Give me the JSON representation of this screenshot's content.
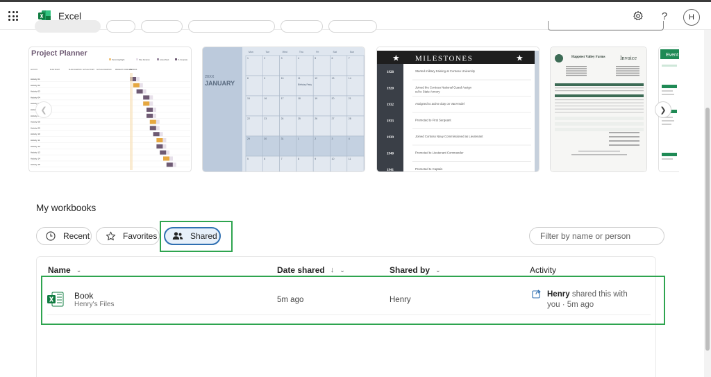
{
  "header": {
    "app_name": "Excel",
    "avatar_initial": "H"
  },
  "templates": {
    "project_planner": {
      "title": "Project Planner",
      "cols": [
        "ACTIVITY",
        "PLAN START",
        "PLAN DURATION",
        "ACTUAL START",
        "ACTUAL DURATION",
        "PERCENT COMPLETE",
        "PERIODS"
      ],
      "rows": [
        "Activity 01",
        "Activity 02",
        "Activity 03",
        "Activity 04",
        "Activity 05",
        "Activity 06",
        "Activity 07",
        "Activity 08",
        "Activity 09",
        "Activity 10",
        "Activity 11",
        "Activity 12",
        "Activity 13",
        "Activity 14",
        "Activity 15"
      ],
      "legend": [
        "Period Highlight",
        "Plan Duration",
        "Actual Start",
        "% Complete"
      ]
    },
    "calendar": {
      "year": "20XX",
      "month": "JANUARY",
      "days": [
        "Mon",
        "Tue",
        "Wed",
        "Thu",
        "Fri",
        "Sat",
        "Sun"
      ],
      "dates": [
        "1",
        "2",
        "3",
        "4",
        "5",
        "6",
        "7",
        "8",
        "9",
        "10",
        "11",
        "12",
        "13",
        "14",
        "15",
        "16",
        "17",
        "18",
        "19",
        "20",
        "21",
        "22",
        "23",
        "24",
        "25",
        "26",
        "27",
        "28",
        "29",
        "30",
        "31",
        "1",
        "2",
        "3",
        "4",
        "5",
        "6",
        "7",
        "8",
        "9",
        "10",
        "11"
      ],
      "note": "Birthday Party"
    },
    "milestones": {
      "title": "MILESTONES",
      "items": [
        {
          "date": "1928",
          "text": "Started military training at Contoso University"
        },
        {
          "date": "1920",
          "text": "Joined the Contoso National Guard Assigned to State Armory"
        },
        {
          "date": "1932",
          "text": "Assigned to active duty on VanArsdel"
        },
        {
          "date": "1933",
          "text": "Promoted to First Sergeant"
        },
        {
          "date": "1939",
          "text": "Joined Contoso Navy Commissioned as Lieutenant"
        },
        {
          "date": "1940",
          "text": "Promoted to Lieutenant Commander"
        },
        {
          "date": "1941",
          "text": "Promoted to Captain"
        }
      ]
    },
    "invoice": {
      "company": "Happiest Valley Farms",
      "title": "Invoice"
    },
    "events": {
      "title": "Event"
    }
  },
  "workbooks": {
    "title": "My workbooks",
    "tabs": [
      {
        "label": "Recent",
        "icon": "clock-icon"
      },
      {
        "label": "Favorites",
        "icon": "star-icon"
      },
      {
        "label": "Shared",
        "icon": "people-icon"
      }
    ],
    "filter_placeholder": "Filter by name or person",
    "columns": {
      "name": "Name",
      "date": "Date shared",
      "by": "Shared by",
      "activity": "Activity"
    },
    "rows": [
      {
        "name": "Book",
        "location": "Henry's Files",
        "date": "5m ago",
        "by": "Henry",
        "activity_user": "Henry",
        "activity_action": "shared this with",
        "activity_rest": "you · 5m ago"
      }
    ]
  },
  "colors": {
    "excel_green": "#107c41",
    "highlight": "#2ea44f",
    "active_tab": "#2f6fb1",
    "gantt_purple": "#6e5a73",
    "gantt_orange": "#e6a840"
  }
}
